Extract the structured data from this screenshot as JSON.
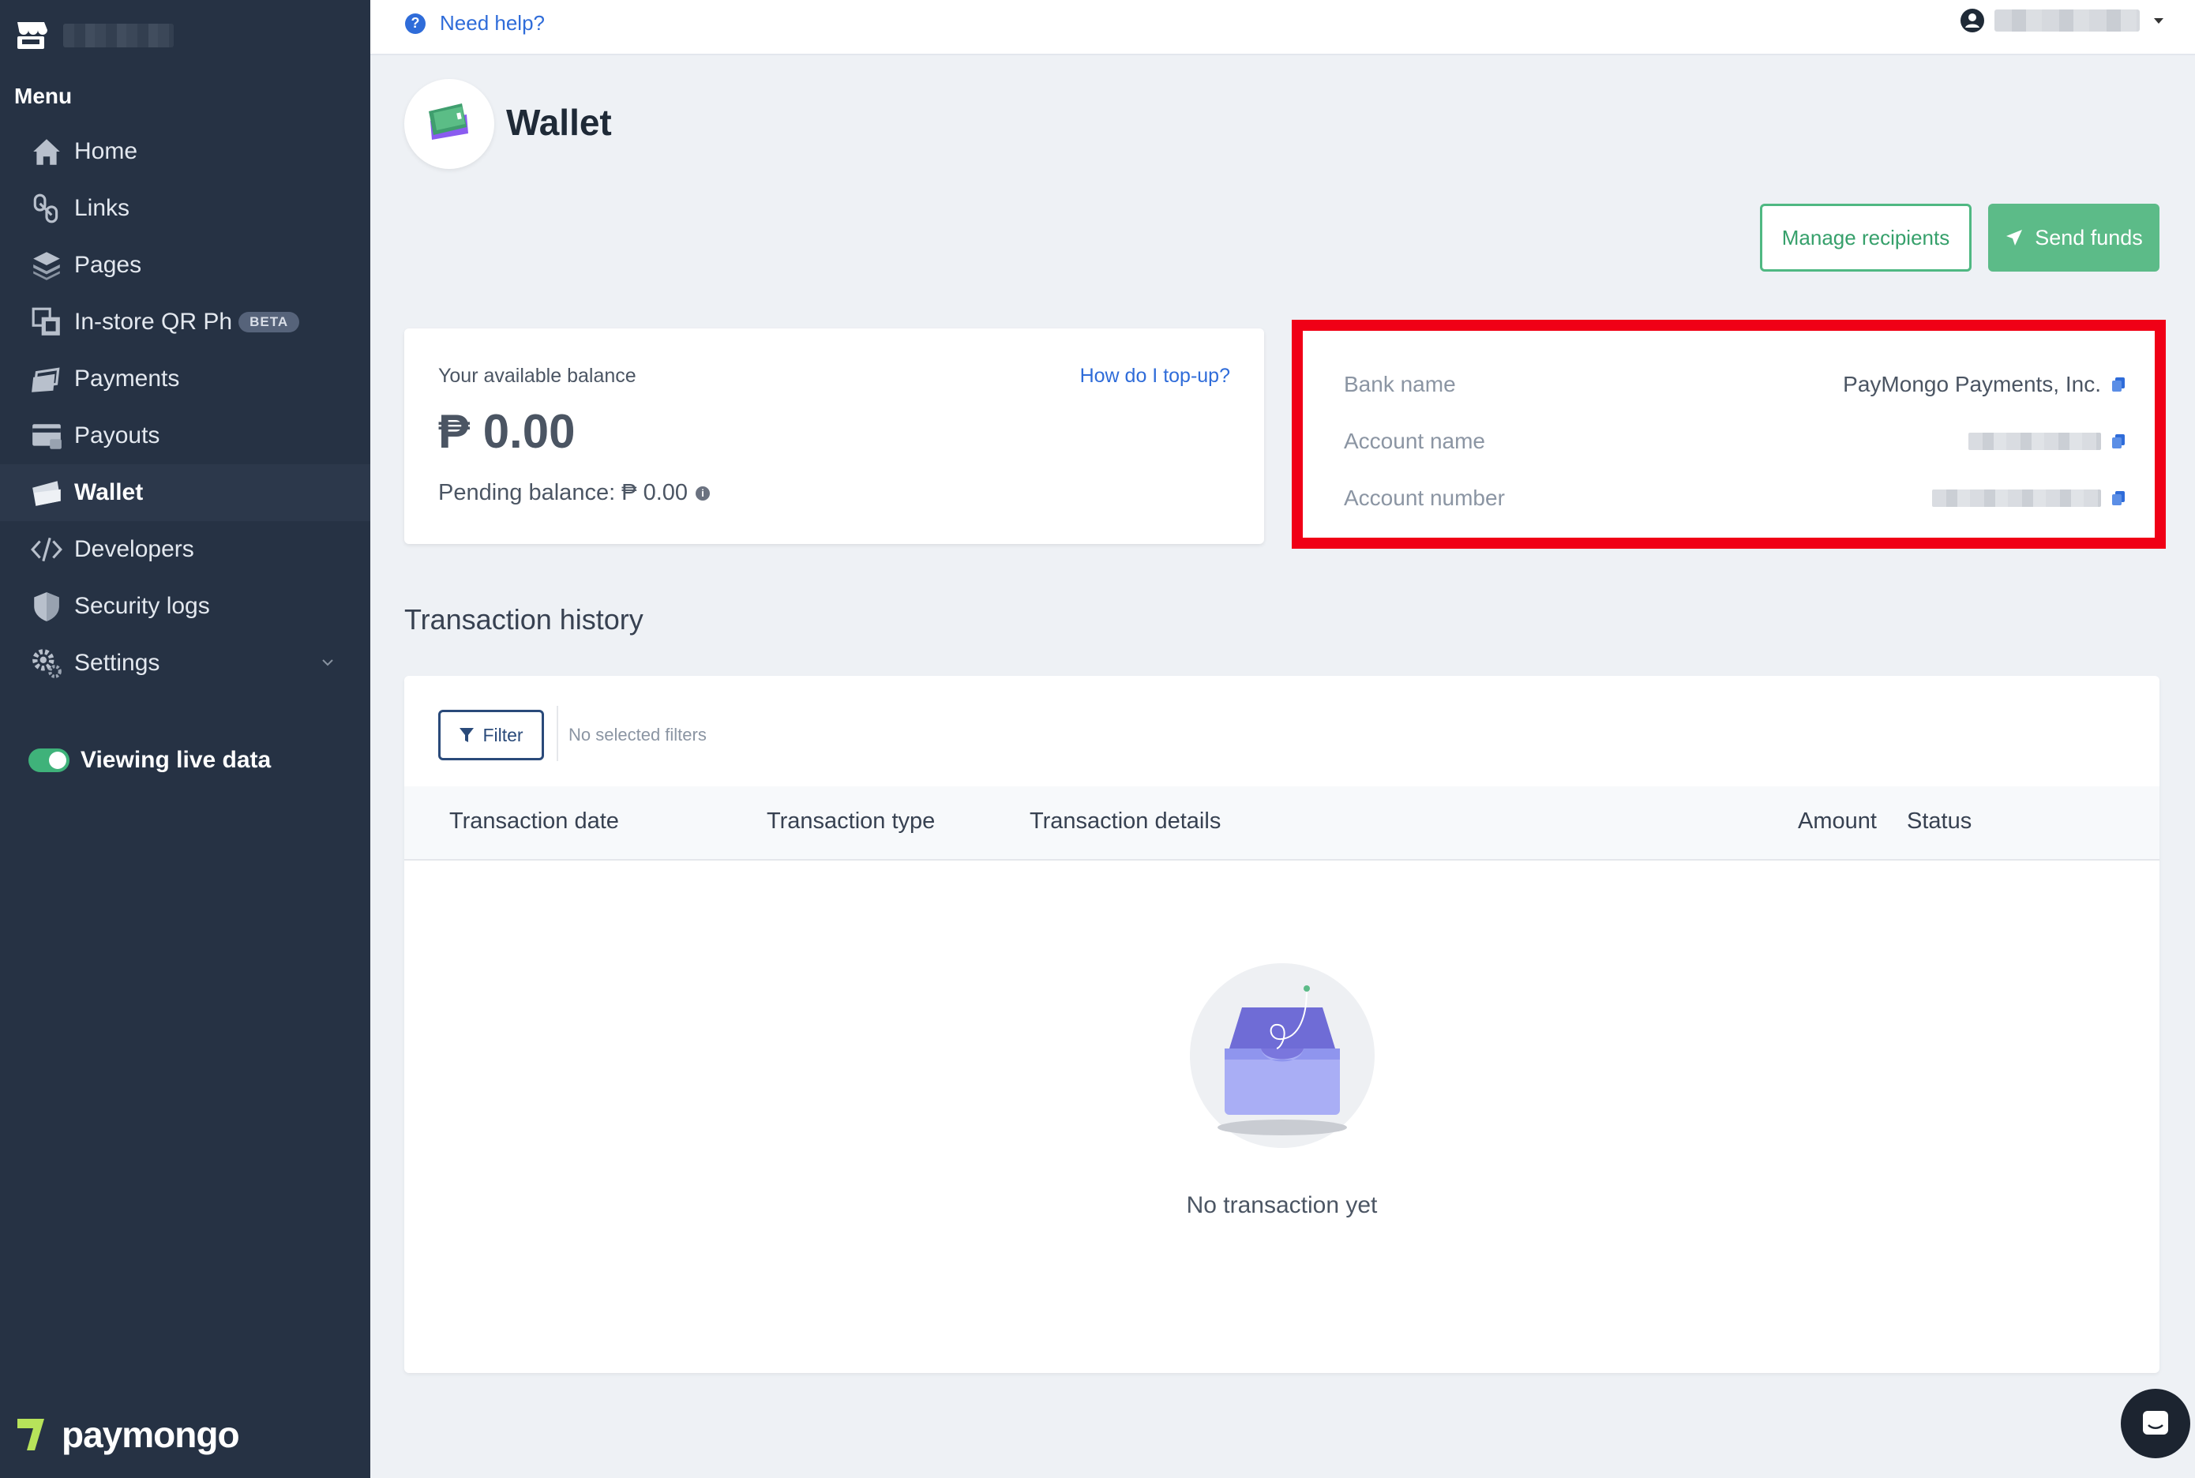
{
  "sidebar": {
    "menu_title": "Menu",
    "items": [
      {
        "label": "Home",
        "icon": "home-icon"
      },
      {
        "label": "Links",
        "icon": "link-icon"
      },
      {
        "label": "Pages",
        "icon": "layers-icon"
      },
      {
        "label": "In-store QR Ph",
        "icon": "qr-store-icon",
        "badge": "BETA"
      },
      {
        "label": "Payments",
        "icon": "payments-icon"
      },
      {
        "label": "Payouts",
        "icon": "payouts-icon"
      },
      {
        "label": "Wallet",
        "icon": "wallet-icon",
        "active": true
      },
      {
        "label": "Developers",
        "icon": "code-icon"
      },
      {
        "label": "Security logs",
        "icon": "shield-icon"
      },
      {
        "label": "Settings",
        "icon": "gear-icon",
        "expandable": true
      }
    ],
    "live_label": "Viewing live data",
    "brand": "paymongo"
  },
  "topbar": {
    "help_label": "Need help?"
  },
  "page": {
    "title": "Wallet",
    "manage_label": "Manage recipients",
    "send_label": "Send funds"
  },
  "balance": {
    "label": "Your available balance",
    "topup_link": "How do I top-up?",
    "value": "₱ 0.00",
    "pending_label": "Pending balance: ₱ 0.00"
  },
  "bank": {
    "bank_name_label": "Bank name",
    "bank_name_value": "PayMongo Payments, Inc.",
    "account_name_label": "Account name",
    "account_number_label": "Account number"
  },
  "transactions": {
    "title": "Transaction history",
    "filter_label": "Filter",
    "no_filters": "No selected filters",
    "columns": [
      "Transaction date",
      "Transaction type",
      "Transaction details",
      "Amount",
      "Status"
    ],
    "empty_text": "No transaction yet"
  },
  "colors": {
    "sidebar_bg": "#263244",
    "accent_green": "#5cbb88",
    "link_blue": "#2f6cd9",
    "highlight_red": "#f00016"
  }
}
